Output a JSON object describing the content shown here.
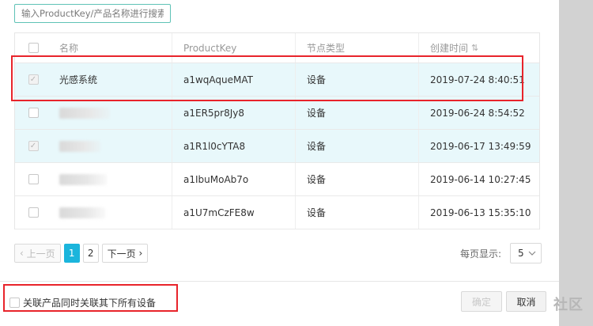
{
  "search": {
    "placeholder": "输入ProductKey/产品名称进行搜索"
  },
  "table": {
    "columns": [
      "名称",
      "ProductKey",
      "节点类型",
      "创建时间"
    ],
    "sort_icon": "sort-icon",
    "rows": [
      {
        "name": "光感系统",
        "name_blurred": false,
        "key": "a1wqAqueMAT",
        "type": "设备",
        "time": "2019-07-24 8:40:51",
        "checked": true,
        "selected": true
      },
      {
        "name": "",
        "name_blurred": true,
        "key": "a1ER5pr8Jy8",
        "type": "设备",
        "time": "2019-06-24 8:54:52",
        "checked": false,
        "selected": true
      },
      {
        "name": "",
        "name_blurred": true,
        "key": "a1R1l0cYTA8",
        "type": "设备",
        "time": "2019-06-17 13:49:59",
        "checked": true,
        "selected": true
      },
      {
        "name": "",
        "name_blurred": true,
        "key": "a1IbuMoAb7o",
        "type": "设备",
        "time": "2019-06-14 10:27:45",
        "checked": false,
        "selected": false
      },
      {
        "name": "",
        "name_blurred": true,
        "key": "a1U7mCzFE8w",
        "type": "设备",
        "time": "2019-06-13 15:35:10",
        "checked": false,
        "selected": false
      }
    ]
  },
  "pagination": {
    "prev": "上一页",
    "pages": [
      "1",
      "2"
    ],
    "current": "1",
    "next": "下一页",
    "per_page_label": "每页显示:",
    "per_page_value": "5"
  },
  "footer": {
    "associate_label": "关联产品同时关联其下所有设备",
    "ok": "确定",
    "cancel": "取消"
  },
  "watermark": {
    "text": "社区"
  },
  "colors": {
    "accent": "#1bb5dc",
    "highlight": "#e8242b",
    "selected_row": "#e8f8fb"
  }
}
